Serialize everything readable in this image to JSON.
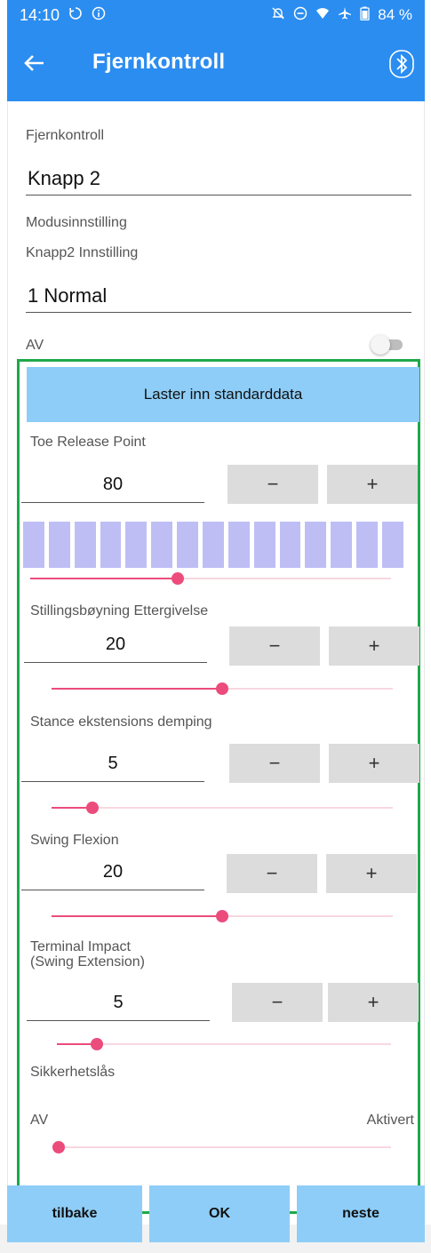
{
  "status_bar": {
    "time": "14:10",
    "battery": "84 %",
    "icons": [
      "sync-icon",
      "info-icon",
      "mute-icon",
      "dnd-icon",
      "wifi-icon",
      "airplane-icon",
      "battery-icon"
    ]
  },
  "app_bar": {
    "title": "Fjernkontroll",
    "background": "#2b8df0"
  },
  "form": {
    "remote_label": "Fjernkontroll",
    "remote_value": "Knapp 2",
    "mode_label": "Modusinnstilling",
    "setting_label": "Knapp2 Innstilling",
    "setting_value": "1 Normal",
    "toggle_label": "AV",
    "toggle_on": false
  },
  "panel": {
    "border_color": "#1fa84a",
    "load_button": "Laster inn standarddata",
    "minus": "−",
    "plus": "+",
    "params": [
      {
        "label": "Toe Release Point",
        "value": "80",
        "slider": 0.41
      },
      {
        "label": "Stillingsbøyning Ettergivelse",
        "value": "20",
        "slider": 0.5
      },
      {
        "label": "Stance ekstensions demping",
        "value": "5",
        "slider": 0.12
      },
      {
        "label": "Swing Flexion",
        "value": "20",
        "slider": 0.5
      },
      {
        "label": "Terminal Impact",
        "label_line2": "(Swing Extension)",
        "value": "5",
        "slider": 0.12
      }
    ],
    "lock": {
      "label": "Sikkerhetslås",
      "min_label": "AV",
      "max_label": "Aktivert",
      "slider": 0.0
    },
    "accent": "#ec4c7c"
  },
  "nav": {
    "back": "tilbake",
    "ok": "OK",
    "next": "neste"
  }
}
